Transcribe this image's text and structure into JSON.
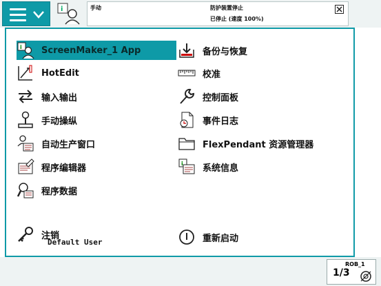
{
  "header": {
    "mode": "手动",
    "status_line1": "防护装置停止",
    "status_line2": "已停止 (速度 100%)"
  },
  "menu": {
    "left": [
      {
        "label": "ScreenMaker_1 App",
        "icon": "screenmaker-icon",
        "selected": true
      },
      {
        "label": "HotEdit",
        "icon": "hotedit-icon"
      },
      {
        "label": "输入输出",
        "icon": "io-icon"
      },
      {
        "label": "手动操纵",
        "icon": "joystick-icon"
      },
      {
        "label": "自动生产窗口",
        "icon": "auto-production-icon"
      },
      {
        "label": "程序编辑器",
        "icon": "program-editor-icon"
      },
      {
        "label": "程序数据",
        "icon": "program-data-icon"
      }
    ],
    "right": [
      {
        "label": "备份与恢复",
        "icon": "backup-icon"
      },
      {
        "label": "校准",
        "icon": "calibration-icon"
      },
      {
        "label": "控制面板",
        "icon": "wrench-icon"
      },
      {
        "label": "事件日志",
        "icon": "event-log-icon"
      },
      {
        "label": "FlexPendant 资源管理器",
        "icon": "folder-icon"
      },
      {
        "label": "系统信息",
        "icon": "system-info-icon"
      }
    ],
    "logout": {
      "label": "注销",
      "user": "Default User",
      "icon": "key-icon"
    },
    "restart": {
      "label": "重新启动",
      "icon": "power-icon"
    }
  },
  "taskbar": {
    "rob_label": "ROB_1",
    "fraction": "1/3",
    "icon": "speed-gear-icon"
  },
  "colors": {
    "accent": "#0e9aa7"
  }
}
